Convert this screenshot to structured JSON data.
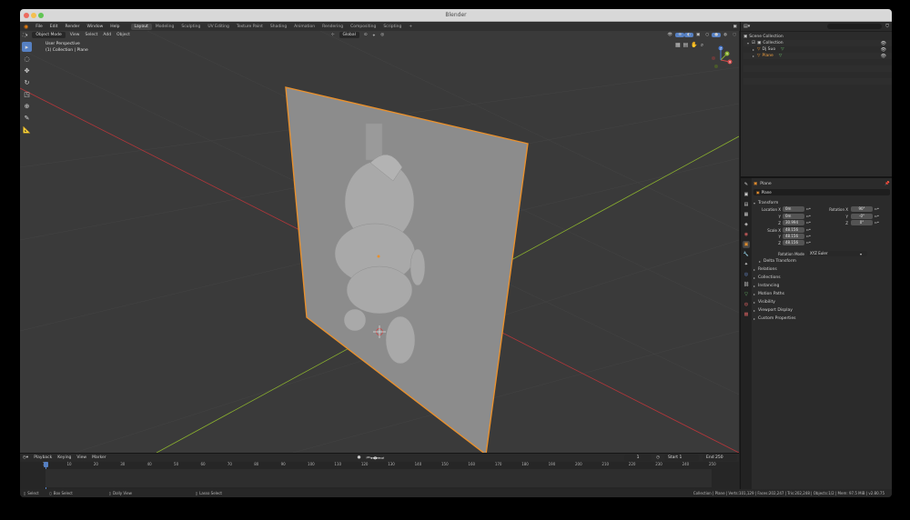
{
  "window": {
    "title": "Blender"
  },
  "menubar": {
    "menus": [
      "File",
      "Edit",
      "Render",
      "Window",
      "Help"
    ],
    "workspaces": [
      "Layout",
      "Modeling",
      "Sculpting",
      "UV Editing",
      "Texture Paint",
      "Shading",
      "Animation",
      "Rendering",
      "Compositing",
      "Scripting"
    ],
    "active_workspace": "Layout",
    "add_tab": "+",
    "scene": "Scene",
    "view_layer": "View Layer"
  },
  "viewport": {
    "mode": "Object Mode",
    "menus": [
      "View",
      "Select",
      "Add",
      "Object"
    ],
    "orientation": "Global",
    "info_line1": "User Perspective",
    "info_line2": "(1) Collection | Plane",
    "gizmo_axes": [
      "X",
      "Y",
      "Z"
    ]
  },
  "timeline": {
    "menus": [
      "Playback",
      "Keying",
      "View",
      "Marker"
    ],
    "current_frame": "1",
    "start_label": "Start",
    "start": "1",
    "end_label": "End",
    "end": "250",
    "ruler": [
      "1",
      "10",
      "20",
      "30",
      "40",
      "50",
      "60",
      "70",
      "80",
      "90",
      "100",
      "110",
      "120",
      "130",
      "140",
      "150",
      "160",
      "170",
      "180",
      "190",
      "200",
      "210",
      "220",
      "230",
      "240",
      "250"
    ]
  },
  "statusbar": {
    "select": "Select",
    "box_select": "Box Select",
    "dolly_view": "Dolly View",
    "lasso_select": "Lasso Select",
    "stats": "Collection | Plane | Verts:101,129 | Faces:202,247 | Tris:202,248 | Objects:1/2 | Mem: 97.5 MiB | v2.80.75"
  },
  "outliner": {
    "scene_collection": "Scene Collection",
    "collection": "Collection",
    "items": [
      "Dj Suo",
      "Plane"
    ]
  },
  "properties": {
    "object_name": "Plane",
    "object_field": "Plane",
    "transform_title": "Transform",
    "location_label": "Location X",
    "loc": [
      "0m",
      "0m",
      "30.994"
    ],
    "rotation_label": "Rotation X",
    "rot": [
      "90°",
      "-0°",
      "0°"
    ],
    "scale_label": "Scale X",
    "scale": [
      "48.156",
      "48.156",
      "48.156"
    ],
    "y_label": "Y",
    "z_label": "Z",
    "rotation_mode_label": "Rotation Mode",
    "rotation_mode": "XYZ Euler",
    "delta_transform": "Delta Transform",
    "sections": [
      "Relations",
      "Collections",
      "Instancing",
      "Motion Paths",
      "Visibility",
      "Viewport Display",
      "Custom Properties"
    ]
  },
  "colors": {
    "accent": "#5680c2",
    "selected_outline": "#e8902d",
    "x_axis": "#b5363a",
    "y_axis": "#8ab02e",
    "viewport_bg": "#3a3a3a"
  }
}
